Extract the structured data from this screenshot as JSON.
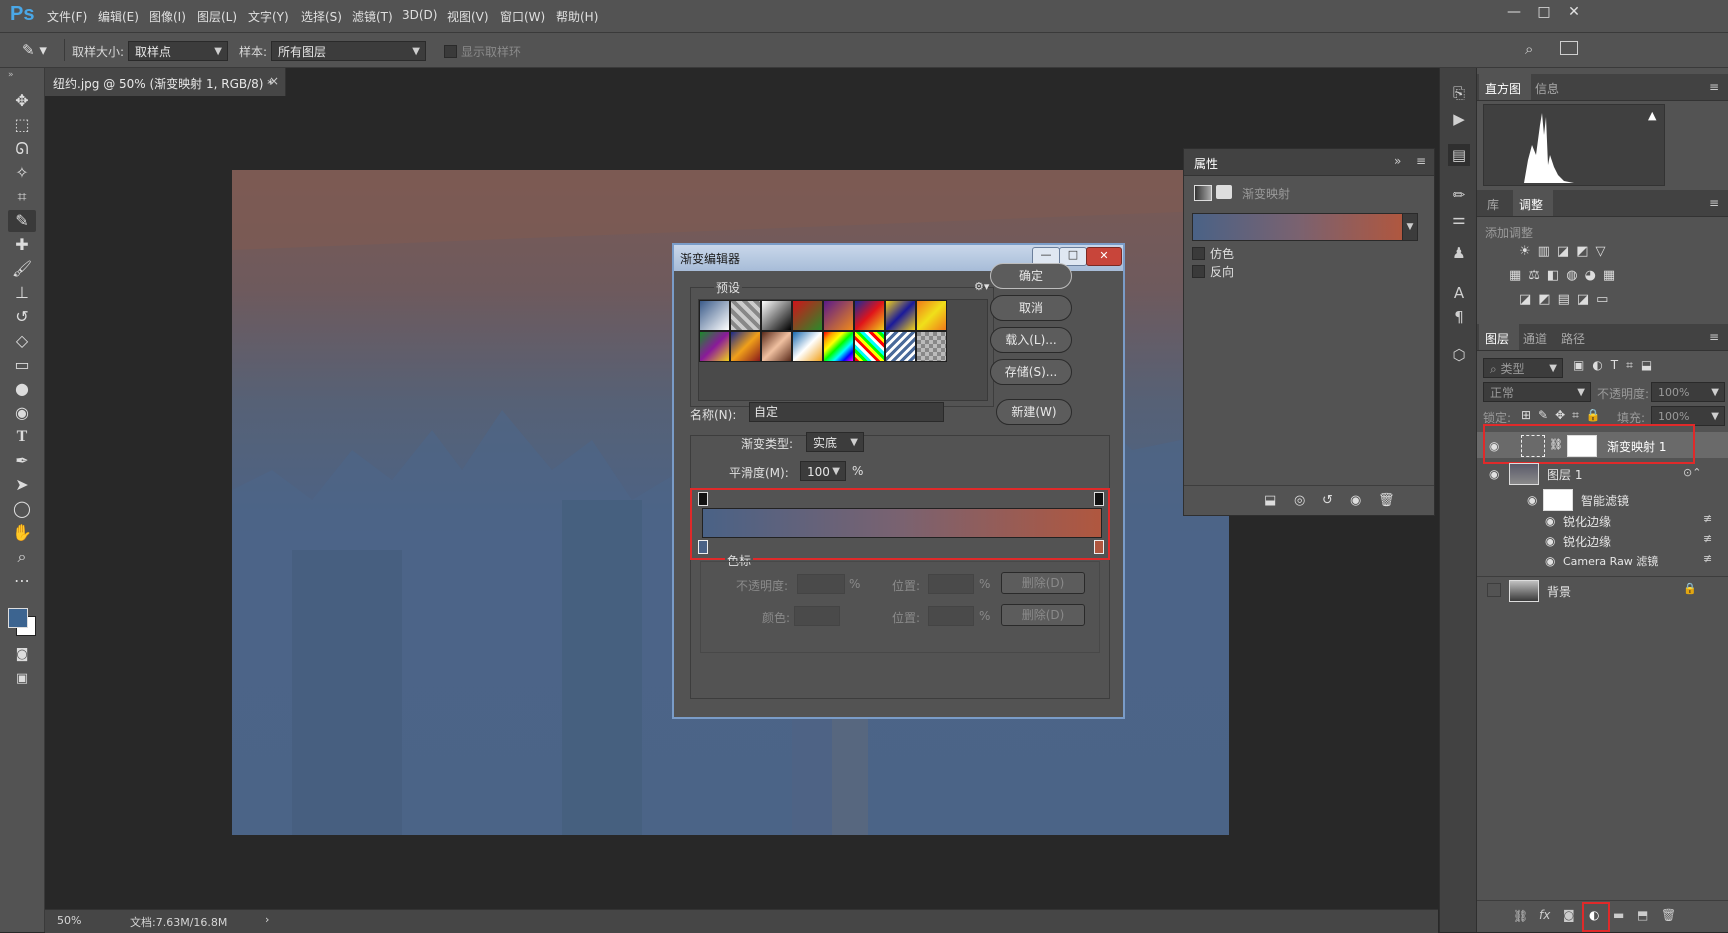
{
  "app": {
    "logo": "Ps"
  },
  "menu": [
    "文件(F)",
    "编辑(E)",
    "图像(I)",
    "图层(L)",
    "文字(Y)",
    "选择(S)",
    "滤镜(T)",
    "3D(D)",
    "视图(V)",
    "窗口(W)",
    "帮助(H)"
  ],
  "window_controls": {
    "minimize": "—",
    "maximize": "□",
    "close": "✕"
  },
  "options": {
    "sample_size_label": "取样大小:",
    "sample_size_value": "取样点",
    "sample_label": "样本:",
    "sample_value": "所有图层",
    "show_ring_label": "显示取样环"
  },
  "document": {
    "tab_title": "纽约.jpg @ 50% (渐变映射 1, RGB/8) *",
    "tab_close": "×",
    "zoom": "50%",
    "doc_info": "文档:7.63M/16.8M",
    "status_arrow": "›"
  },
  "panels": {
    "histogram_tabs": [
      "直方图",
      "信息"
    ],
    "adjust_tabs": [
      "库",
      "调整"
    ],
    "add_adjustment": "添加调整",
    "layers_tabs": [
      "图层",
      "通道",
      "路径"
    ],
    "layer_filter_kind": "类型",
    "blend_mode": "正常",
    "opacity_label": "不透明度:",
    "opacity_value": "100%",
    "lock_label": "锁定:",
    "fill_label": "填充:",
    "fill_value": "100%"
  },
  "layers": [
    {
      "name": "渐变映射 1",
      "type": "adjustment",
      "visible": true
    },
    {
      "name": "图层 1",
      "type": "smart",
      "visible": true
    },
    {
      "name": "智能滤镜",
      "type": "filter-group",
      "visible": true
    },
    {
      "name": "锐化边缘",
      "type": "filter",
      "visible": true
    },
    {
      "name": "锐化边缘",
      "type": "filter",
      "visible": true
    },
    {
      "name": "Camera Raw 滤镜",
      "type": "filter",
      "visible": true
    },
    {
      "name": "背景",
      "type": "background",
      "visible": false
    }
  ],
  "properties_panel": {
    "title": "属性",
    "mode_label": "渐变映射",
    "dither_label": "仿色",
    "reverse_label": "反向",
    "collapse": "»",
    "menu": "≡"
  },
  "gradient_editor": {
    "title": "渐变编辑器",
    "presets_label": "预设",
    "buttons": {
      "ok": "确定",
      "cancel": "取消",
      "load": "载入(L)...",
      "save": "存储(S)...",
      "new": "新建(W)"
    },
    "name_label": "名称(N):",
    "name_value": "自定",
    "gradient_type_label": "渐变类型:",
    "gradient_type_value": "实底",
    "smoothness_label": "平滑度(M):",
    "smoothness_value": "100",
    "percent": "%",
    "stops_label": "色标",
    "opacity_label": "不透明度:",
    "color_label": "颜色:",
    "location_label": "位置:",
    "delete_label": "删除(D)",
    "gradient_start": "#4a6286",
    "gradient_end": "#b0573f"
  },
  "colors": {
    "accent_red": "#e02a2a",
    "panel_bg": "#535353",
    "canvas_blue": "#4a6286",
    "canvas_rust": "#8a5545"
  }
}
